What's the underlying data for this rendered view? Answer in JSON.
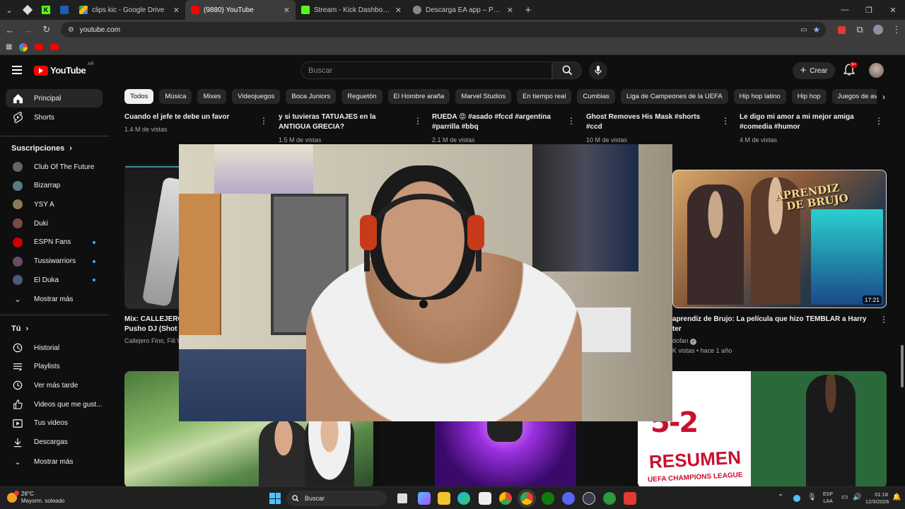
{
  "browser": {
    "tabs": [
      {
        "title": "clips kic - Google Drive",
        "color": "#fbbc04"
      },
      {
        "title": "(9880) YouTube",
        "color": "#ff0000",
        "active": true
      },
      {
        "title": "Stream - Kick Dashboard",
        "color": "#53fc18"
      },
      {
        "title": "Descarga EA app – Potenciando",
        "color": "#aaaaaa"
      }
    ],
    "url": "youtube.com"
  },
  "youtube": {
    "logo": "YouTube",
    "region": "AR",
    "search_placeholder": "Buscar",
    "create_label": "Crear",
    "notif_badge": "9+"
  },
  "chips": [
    "Todos",
    "Música",
    "Mixes",
    "Videojuegos",
    "Boca Juniors",
    "Reguetón",
    "El Hombre araña",
    "Marvel Studios",
    "En tiempo real",
    "Cumbias",
    "Liga de Campeones de la UEFA",
    "Hip hop latino",
    "Hip hop",
    "Juegos de av"
  ],
  "sidebar": {
    "main": [
      {
        "label": "Principal",
        "icon": "home-icon"
      },
      {
        "label": "Shorts",
        "icon": "shorts-icon"
      }
    ],
    "subs_title": "Suscripciones",
    "subs": [
      {
        "label": "Club Of The Future",
        "color": "#666666",
        "live": false
      },
      {
        "label": "Bizarrap",
        "color": "#5a7a8a",
        "live": false
      },
      {
        "label": "YSY A",
        "color": "#8a7a5a",
        "live": false
      },
      {
        "label": "Duki",
        "color": "#7a4a4a",
        "live": false
      },
      {
        "label": "ESPN Fans",
        "color": "#cc0000",
        "live": true
      },
      {
        "label": "Tussiwarriors",
        "color": "#6a4a6a",
        "live": true
      },
      {
        "label": "El Duka",
        "color": "#4a5a7a",
        "live": true
      }
    ],
    "subs_more": "Mostrar más",
    "you_title": "Tú",
    "you": [
      {
        "label": "Historial",
        "icon": "history-icon"
      },
      {
        "label": "Playlists",
        "icon": "playlists-icon"
      },
      {
        "label": "Ver más tarde",
        "icon": "watch-later-icon"
      },
      {
        "label": "Videos que me gust...",
        "icon": "liked-icon"
      },
      {
        "label": "Tus videos",
        "icon": "your-videos-icon"
      },
      {
        "label": "Descargas",
        "icon": "downloads-icon"
      }
    ],
    "you_more": "Mostrar más"
  },
  "shorts_row": [
    {
      "title": "Cuando el jefe te debe un favor",
      "views": "1.4 M de vistas"
    },
    {
      "title": "y si tuvieras TATUAJES en la ANTIGUA GRECIA?",
      "views": "1.5 M de vistas"
    },
    {
      "title": "RUEDA 😡 #asado #fccd #argentina #parrilla #bbq",
      "views": "2.1 M de vistas"
    },
    {
      "title": "Ghost Removes His Mask #shorts #ccd",
      "views": "10 M de vistas"
    },
    {
      "title": "Le digo mi amor a mi mejor amiga #comedia #humor",
      "views": "4 M de vistas"
    }
  ],
  "videos": [
    {
      "title_l1": "Mix: CALLEJERO",
      "title_l2": "Pusho DJ (Shot",
      "meta": "Callejero Fino, Fili W"
    },
    {
      "title_l1": "aprendiz de Brujo: La película que hizo TEMBLAR a Harry",
      "title_l2": "ter",
      "channel": "dofan",
      "meta": "K vistas • hace 1 año",
      "duration": "17:21",
      "thumb_text_1": "APRENDIZ",
      "thumb_text_2": "DE BRUJO"
    }
  ],
  "bottom_thumb": {
    "score": "5-2",
    "headline": "RESUMEN",
    "sub": "UEFA CHAMPIONS LEAGUE"
  },
  "taskbar": {
    "weather_temp": "26°C",
    "weather_desc": "Mayorm. soleado",
    "search": "Buscar",
    "lang": "ESP",
    "lang2": "LAA",
    "time": "01:18",
    "date": "12/3/2026"
  }
}
